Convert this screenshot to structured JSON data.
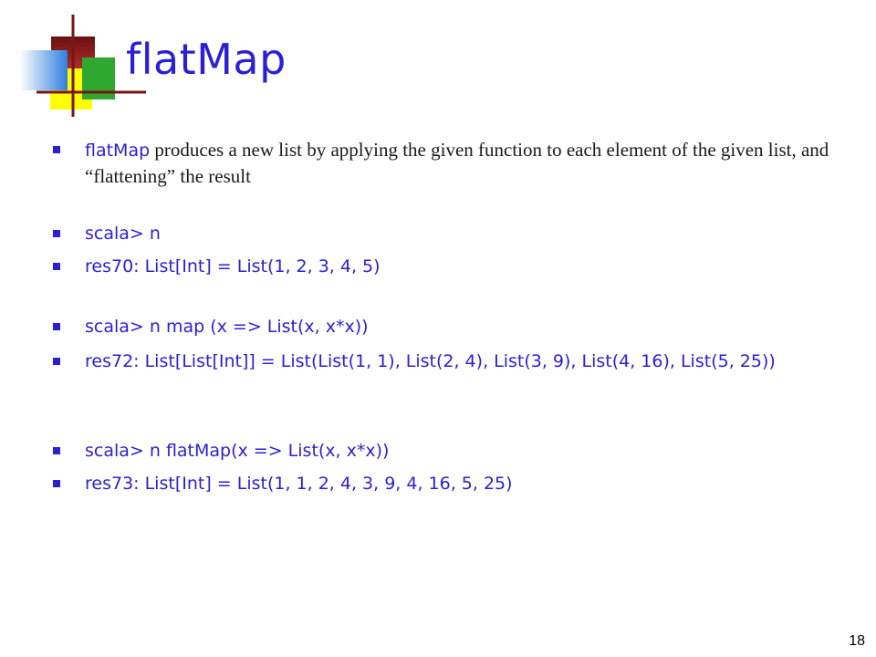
{
  "slide": {
    "title": "flatMap",
    "page_number": "18"
  },
  "bullets": [
    {
      "code_prefix": "flatMap",
      "text": " produces a new list by applying the given function to each element of the given list, and “flattening” the result"
    },
    {
      "text": "scala> n"
    },
    {
      "text": "res70: List[Int] = List(1, 2, 3, 4, 5)"
    },
    {
      "text": "scala> n map (x => List(x, x*x))"
    },
    {
      "text": "res72: List[List[Int]] = List(List(1, 1), List(2, 4), List(3, 9), List(4, 16), List(5, 25))"
    },
    {
      "text": "scala> n flatMap(x => List(x, x*x))"
    },
    {
      "text": "res73: List[Int] = List(1, 1, 2, 4, 3, 9, 4, 16, 5, 25)"
    }
  ],
  "colors": {
    "title": "#2b1fd6",
    "bullet_text": "#2b1fd6",
    "serif_text": "#1a1a1a",
    "logo_red": "#8b1a1a",
    "logo_yellow": "#ffff00",
    "logo_green": "#22aa22",
    "logo_blue": "#3a8fe0"
  }
}
